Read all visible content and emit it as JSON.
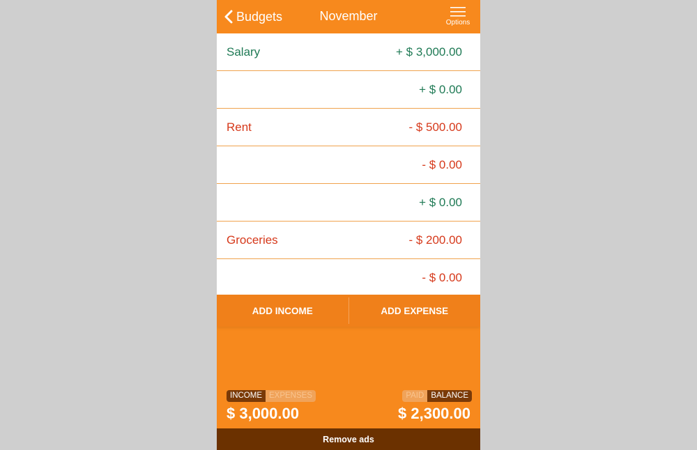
{
  "header": {
    "back_label": "Budgets",
    "title": "November",
    "options_label": "Options"
  },
  "rows": [
    {
      "label": "Salary",
      "amount": "+ $ 3,000.00",
      "kind": "income"
    },
    {
      "label": "",
      "amount": "+ $ 0.00",
      "kind": "income"
    },
    {
      "label": "Rent",
      "amount": "- $ 500.00",
      "kind": "expense"
    },
    {
      "label": "",
      "amount": "- $ 0.00",
      "kind": "expense"
    },
    {
      "label": "",
      "amount": "+ $ 0.00",
      "kind": "income"
    },
    {
      "label": "Groceries",
      "amount": "- $ 200.00",
      "kind": "expense"
    },
    {
      "label": "",
      "amount": "- $ 0.00",
      "kind": "expense"
    }
  ],
  "actions": {
    "add_income": "ADD INCOME",
    "add_expense": "ADD EXPENSE"
  },
  "summary": {
    "left_toggle": {
      "income": "INCOME",
      "expenses": "EXPENSES",
      "selected": "income"
    },
    "right_toggle": {
      "paid": "PAID",
      "balance": "BALANCE",
      "selected": "balance"
    },
    "left_amount": "$ 3,000.00",
    "right_amount": "$ 2,300.00"
  },
  "ads": {
    "label": "Remove ads"
  },
  "colors": {
    "accent": "#f7891d",
    "income": "#1f7a55",
    "expense": "#d6391b",
    "ads_bar": "#6b3100"
  },
  "icons": {
    "back": "chevron-left-icon",
    "options": "hamburger-menu-icon"
  }
}
